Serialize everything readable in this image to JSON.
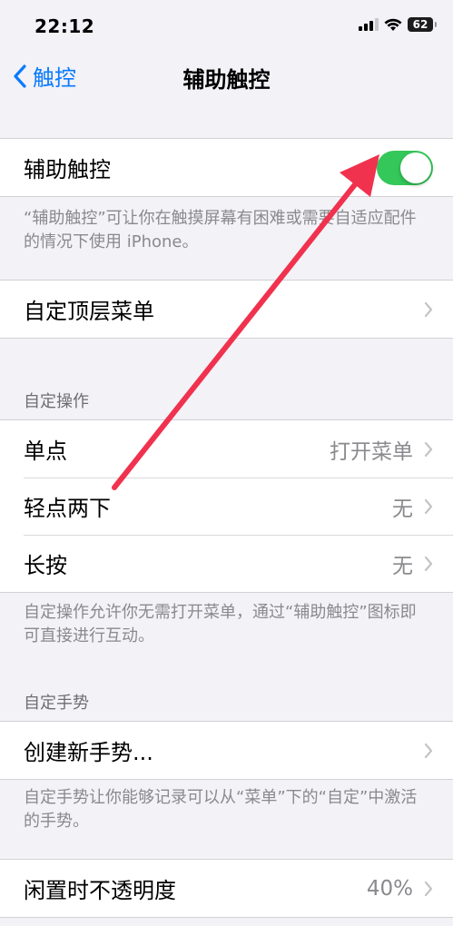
{
  "status_bar": {
    "time": "22:12",
    "battery": "62",
    "icons": [
      "signal-icon",
      "wifi-icon",
      "battery-icon"
    ]
  },
  "nav": {
    "back_label": "触控",
    "title": "辅助触控"
  },
  "sections": {
    "assistive_touch": {
      "label": "辅助触控",
      "toggle_on": true,
      "footer": "“辅助触控”可让你在触摸屏幕有困难或需要自适应配件的情况下使用 iPhone。"
    },
    "top_menu": {
      "label": "自定顶层菜单"
    },
    "custom_actions": {
      "header": "自定操作",
      "items": [
        {
          "label": "单点",
          "value": "打开菜单"
        },
        {
          "label": "轻点两下",
          "value": "无"
        },
        {
          "label": "长按",
          "value": "无"
        }
      ],
      "footer": "自定操作允许你无需打开菜单，通过“辅助触控”图标即可直接进行互动。"
    },
    "custom_gestures": {
      "header": "自定手势",
      "create_label": "创建新手势...",
      "footer": "自定手势让你能够记录可以从“菜单”下的“自定”中激活的手势。"
    },
    "idle_opacity": {
      "label": "闲置时不透明度",
      "value": "40%"
    }
  },
  "colors": {
    "accent": "#0a7aff",
    "toggle_on": "#34c759",
    "annotation_arrow": "#f0324f",
    "background": "#f2f2f7"
  }
}
